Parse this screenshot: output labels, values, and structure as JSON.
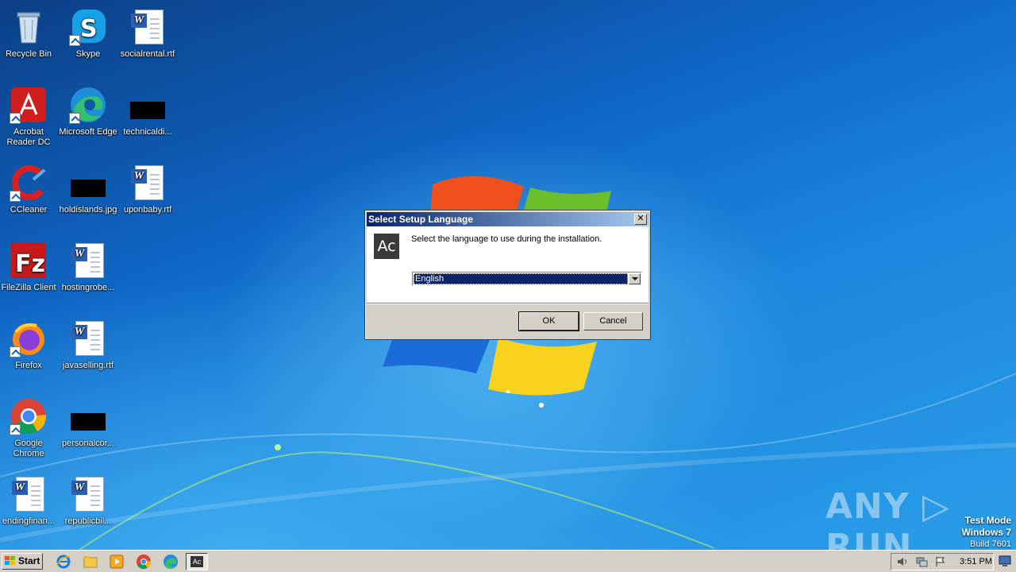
{
  "desktop": {
    "icons": [
      {
        "label": "Recycle Bin"
      },
      {
        "label": "Skype"
      },
      {
        "label": "socialrental.rtf"
      },
      {
        "label": "Acrobat Reader DC"
      },
      {
        "label": "Microsoft Edge"
      },
      {
        "label": "technicaldi..."
      },
      {
        "label": "CCleaner"
      },
      {
        "label": "holdislands.jpg"
      },
      {
        "label": "uponbaby.rtf"
      },
      {
        "label": "FileZilla Client"
      },
      {
        "label": "hostingrobe..."
      },
      {
        "label": "Firefox"
      },
      {
        "label": "javaselling.rtf"
      },
      {
        "label": "Google Chrome"
      },
      {
        "label": "personalcor..."
      },
      {
        "label": "endingfinan..."
      },
      {
        "label": "republicbil..."
      }
    ]
  },
  "dialog": {
    "title": "Select Setup Language",
    "close_label": "✕",
    "app_icon_text": "Ac",
    "prompt": "Select the language to use during the installation.",
    "language_selected": "English",
    "ok_label": "OK",
    "cancel_label": "Cancel"
  },
  "watermark": {
    "brand": "ANY ▷ RUN",
    "line1": "Test Mode",
    "line2": "Windows 7",
    "line3": "Build 7601"
  },
  "taskbar": {
    "start_label": "Start",
    "active_app_text": "Ac",
    "clock": "3:51 PM"
  },
  "colors": {
    "title_start": "#0a246a",
    "title_end": "#a6caf0",
    "selection": "#0a246a"
  }
}
